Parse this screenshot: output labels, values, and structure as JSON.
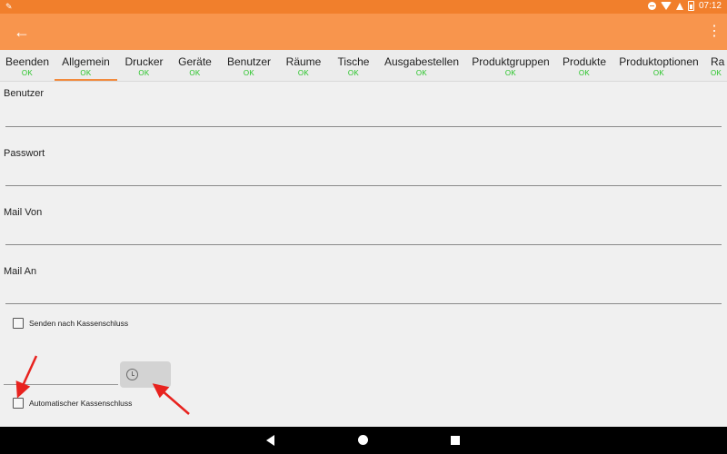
{
  "status_bar": {
    "time": "07:12",
    "icons": [
      "app-notification-icon",
      "do-not-disturb-icon",
      "wifi-icon",
      "data-arrow-icon",
      "battery-icon"
    ]
  },
  "app_bar": {
    "back_icon": "arrow-left-icon",
    "overflow_icon": "more-vert-icon",
    "color": "#f8954d"
  },
  "tabs": [
    {
      "label": "Beenden",
      "status": "OK"
    },
    {
      "label": "Allgemein",
      "status": "OK",
      "active": true
    },
    {
      "label": "Drucker",
      "status": "OK"
    },
    {
      "label": "Geräte",
      "status": "OK"
    },
    {
      "label": "Benutzer",
      "status": "OK"
    },
    {
      "label": "Räume",
      "status": "OK"
    },
    {
      "label": "Tische",
      "status": "OK"
    },
    {
      "label": "Ausgabestellen",
      "status": "OK"
    },
    {
      "label": "Produktgruppen",
      "status": "OK"
    },
    {
      "label": "Produkte",
      "status": "OK"
    },
    {
      "label": "Produktoptionen",
      "status": "OK"
    },
    {
      "label": "Ra",
      "status": "OK"
    }
  ],
  "form": {
    "fields": [
      {
        "label": "Benutzer",
        "value": ""
      },
      {
        "label": "Passwort",
        "value": ""
      },
      {
        "label": "Mail Von",
        "value": ""
      },
      {
        "label": "Mail An",
        "value": ""
      }
    ],
    "send_after_close": {
      "label": "Senden nach Kassenschluss",
      "checked": false
    },
    "time_value": "",
    "time_button_icon": "clock-icon",
    "auto_close": {
      "label": "Automatischer Kassenschluss",
      "checked": false
    }
  },
  "nav_bar": {
    "icons": [
      "back-triangle-icon",
      "home-circle-icon",
      "recent-square-icon"
    ]
  },
  "annotation_color": "#e8221e"
}
